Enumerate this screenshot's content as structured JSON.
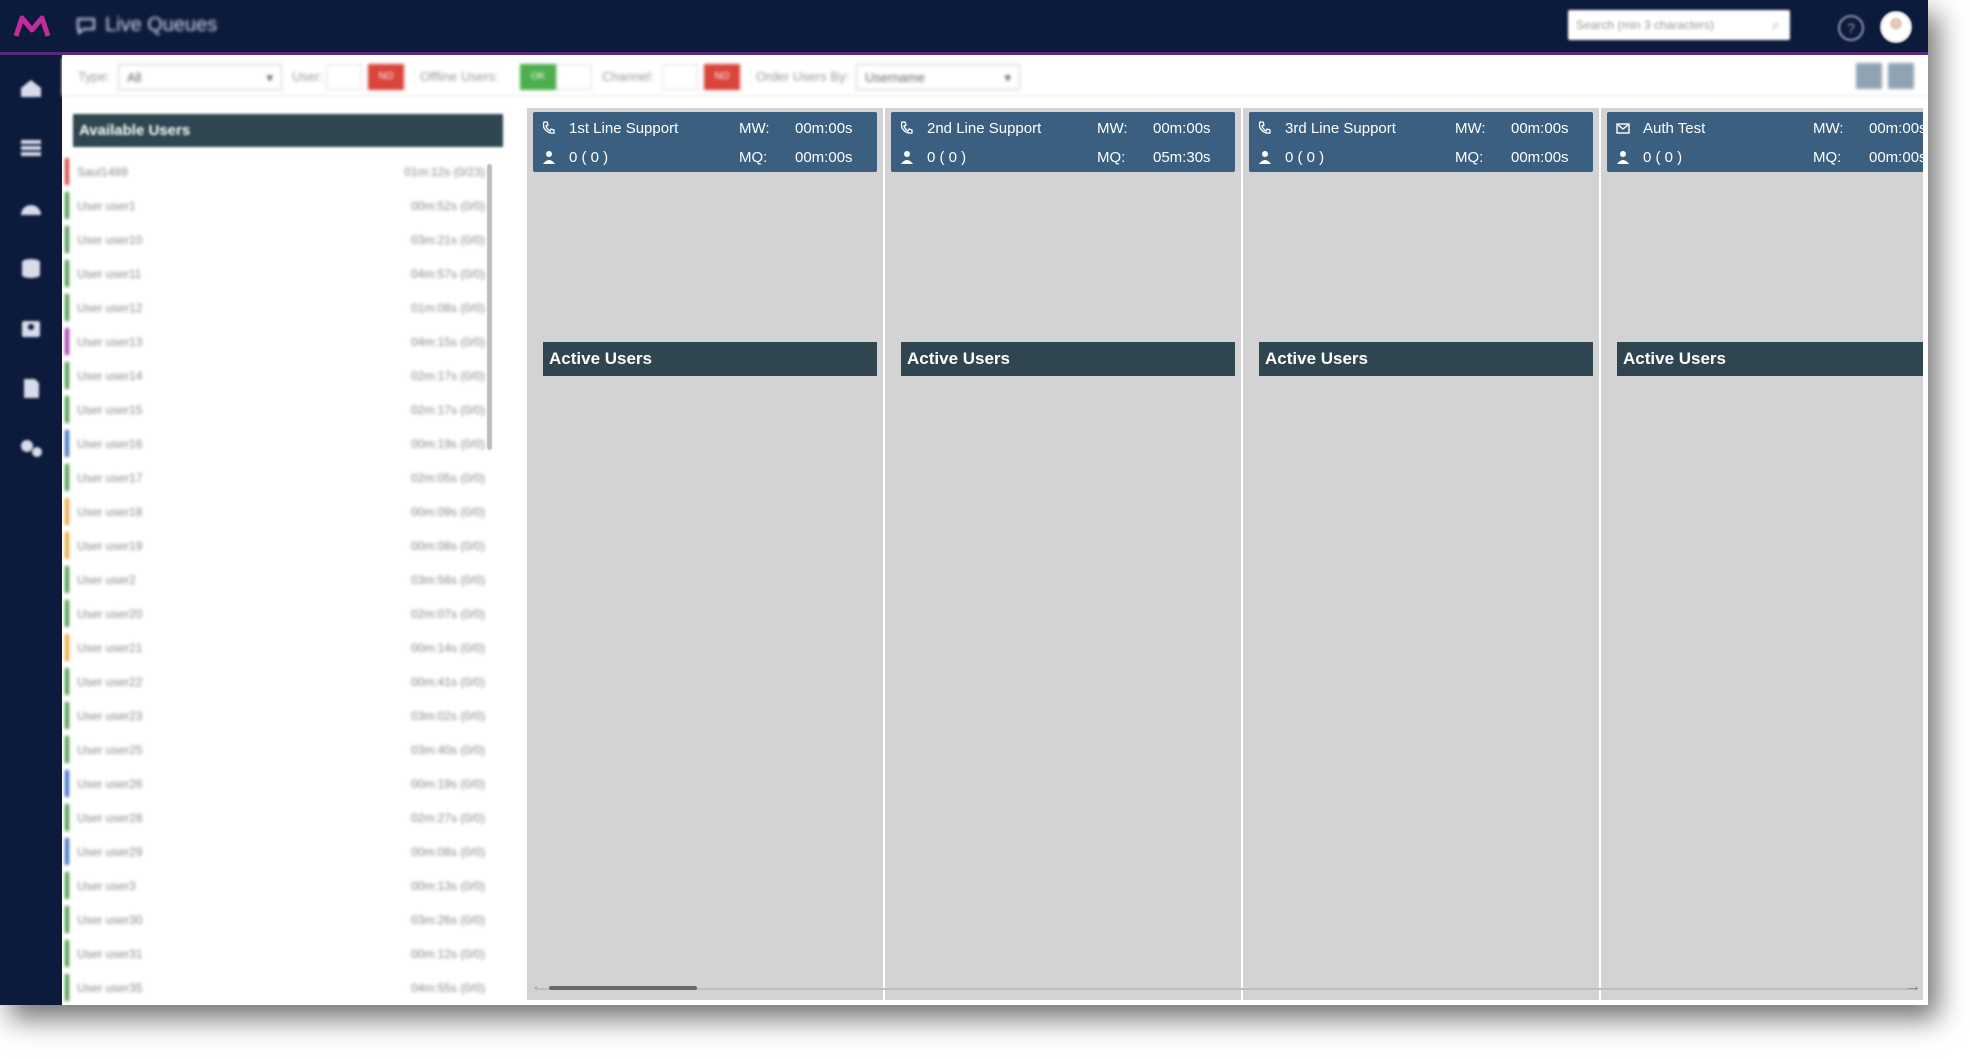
{
  "app": {
    "title": "Live Queues",
    "search_placeholder": "Search (min 3 characters)",
    "help_label": "?"
  },
  "filters": {
    "type_label": "Type:",
    "type_value": "All",
    "user_label": "User:",
    "user_toggle": "NO",
    "offline_label": "Offline Users:",
    "offline_toggle": "OK",
    "channel_label": "Channel:",
    "channel_toggle": "NO",
    "order_label": "Order Users By:",
    "order_value": "Username"
  },
  "available_users": {
    "title": "Available Users",
    "users": [
      {
        "name": "Saul1489",
        "time": "01m:12s (0/23)",
        "color": "#d9443b"
      },
      {
        "name": "User user1",
        "time": "00m:52s (0/0)",
        "color": "#4c9a4c"
      },
      {
        "name": "User user10",
        "time": "03m:21s (0/0)",
        "color": "#4c9a4c"
      },
      {
        "name": "User user11",
        "time": "04m:57s (0/0)",
        "color": "#4c9a4c"
      },
      {
        "name": "User user12",
        "time": "01m:08s (0/0)",
        "color": "#4c9a4c"
      },
      {
        "name": "User user13",
        "time": "04m:15s (0/0)",
        "color": "#a63aa6"
      },
      {
        "name": "User user14",
        "time": "02m:17s (0/0)",
        "color": "#4c9a4c"
      },
      {
        "name": "User user15",
        "time": "02m:17s (0/0)",
        "color": "#4c9a4c"
      },
      {
        "name": "User user16",
        "time": "00m:19s (0/0)",
        "color": "#3a6fc4"
      },
      {
        "name": "User user17",
        "time": "02m:05s (0/0)",
        "color": "#4c9a4c"
      },
      {
        "name": "User user18",
        "time": "00m:09s (0/0)",
        "color": "#e8a838"
      },
      {
        "name": "User user19",
        "time": "00m:08s (0/0)",
        "color": "#e8a838"
      },
      {
        "name": "User user2",
        "time": "03m:56s (0/0)",
        "color": "#4c9a4c"
      },
      {
        "name": "User user20",
        "time": "02m:07s (0/0)",
        "color": "#4c9a4c"
      },
      {
        "name": "User user21",
        "time": "00m:14s (0/0)",
        "color": "#e8a838"
      },
      {
        "name": "User user22",
        "time": "00m:41s (0/0)",
        "color": "#4c9a4c"
      },
      {
        "name": "User user23",
        "time": "03m:02s (0/0)",
        "color": "#4c9a4c"
      },
      {
        "name": "User user25",
        "time": "03m:40s (0/0)",
        "color": "#4c9a4c"
      },
      {
        "name": "User user26",
        "time": "00m:19s (0/0)",
        "color": "#3a6fc4"
      },
      {
        "name": "User user28",
        "time": "02m:27s (0/0)",
        "color": "#4c9a4c"
      },
      {
        "name": "User user29",
        "time": "00m:08s (0/0)",
        "color": "#3a6fc4"
      },
      {
        "name": "User user3",
        "time": "00m:13s (0/0)",
        "color": "#4c9a4c"
      },
      {
        "name": "User user30",
        "time": "03m:26s (0/0)",
        "color": "#4c9a4c"
      },
      {
        "name": "User user31",
        "time": "00m:12s (0/0)",
        "color": "#4c9a4c"
      },
      {
        "name": "User user35",
        "time": "04m:55s (0/0)",
        "color": "#4c9a4c"
      }
    ]
  },
  "queues": [
    {
      "name": "1st Line Support",
      "icon": "phone-icon",
      "count": "0 ( 0 )",
      "mw_label": "MW:",
      "mw": "00m:00s",
      "mq_label": "MQ:",
      "mq": "00m:00s",
      "active_label": "Active Users"
    },
    {
      "name": "2nd Line Support",
      "icon": "phone-icon",
      "count": "0 ( 0 )",
      "mw_label": "MW:",
      "mw": "00m:00s",
      "mq_label": "MQ:",
      "mq": "05m:30s",
      "active_label": "Active Users"
    },
    {
      "name": "3rd Line Support",
      "icon": "phone-icon",
      "count": "0 ( 0 )",
      "mw_label": "MW:",
      "mw": "00m:00s",
      "mq_label": "MQ:",
      "mq": "00m:00s",
      "active_label": "Active Users"
    },
    {
      "name": "Auth Test",
      "icon": "email-icon",
      "count": "0 ( 0 )",
      "mw_label": "MW:",
      "mw": "00m:00s",
      "mq_label": "MQ:",
      "mq": "00m:00s",
      "active_label": "Active Users"
    }
  ],
  "colors": {
    "topbar": "#0c1a3c",
    "queue_header": "#3a5f80",
    "active_users_bar": "#2f4650",
    "toggle_no": "#d9443b",
    "toggle_ok": "#4cae4c"
  }
}
